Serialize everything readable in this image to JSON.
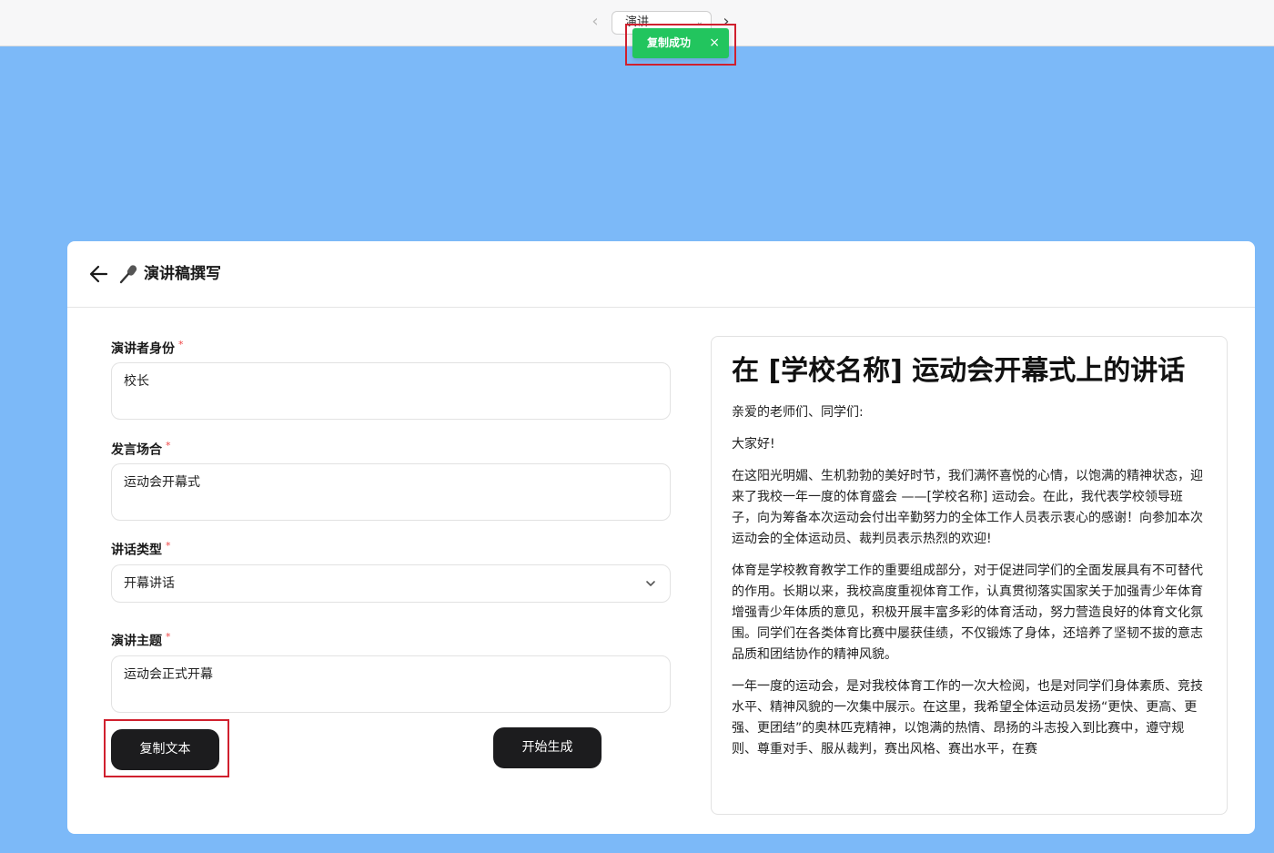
{
  "topbar": {
    "tab_label": "演讲...",
    "prev_icon": "chevron-left-icon",
    "next_icon": "chevron-right-icon"
  },
  "toast": {
    "message": "复制成功",
    "close": "×",
    "color": "#22c55e"
  },
  "page": {
    "title": "演讲稿撰写",
    "back_icon": "arrow-left-icon",
    "title_icon": "microphone-icon"
  },
  "form": {
    "speaker": {
      "label": "演讲者身份",
      "required": "*",
      "value": "校长"
    },
    "occasion": {
      "label": "发言场合",
      "required": "*",
      "value": "运动会开幕式"
    },
    "speech_type": {
      "label": "讲话类型",
      "required": "*",
      "value": "开幕讲话"
    },
    "topic": {
      "label": "演讲主题",
      "required": "*",
      "value": "运动会正式开幕"
    },
    "copy_button": "复制文本",
    "generate_button": "开始生成"
  },
  "preview": {
    "title": "在 [学校名称] 运动会开幕式上的讲话",
    "paragraphs": [
      "亲爱的老师们、同学们:",
      "大家好!",
      "在这阳光明媚、生机勃勃的美好时节，我们满怀喜悦的心情，以饱满的精神状态，迎来了我校一年一度的体育盛会 ——[学校名称] 运动会。在此，我代表学校领导班子，向为筹备本次运动会付出辛勤努力的全体工作人员表示衷心的感谢！向参加本次运动会的全体运动员、裁判员表示热烈的欢迎!",
      "体育是学校教育教学工作的重要组成部分，对于促进同学们的全面发展具有不可替代的作用。长期以来，我校高度重视体育工作，认真贯彻落实国家关于加强青少年体育增强青少年体质的意见，积极开展丰富多彩的体育活动，努力营造良好的体育文化氛围。同学们在各类体育比赛中屡获佳绩，不仅锻炼了身体，还培养了坚韧不拔的意志品质和团结协作的精神风貌。",
      "一年一度的运动会，是对我校体育工作的一次大检阅，也是对同学们身体素质、竞技水平、精神风貌的一次集中展示。在这里，我希望全体运动员发扬“更快、更高、更强、更团结”的奥林匹克精神，以饱满的热情、昂扬的斗志投入到比赛中，遵守规则、尊重对手、服从裁判，赛出风格、赛出水平，在赛"
    ]
  },
  "colors": {
    "background": "#7cb9f8",
    "button_dark": "#1c1c1e",
    "required": "#ef4444",
    "highlight": "#d0202e"
  }
}
